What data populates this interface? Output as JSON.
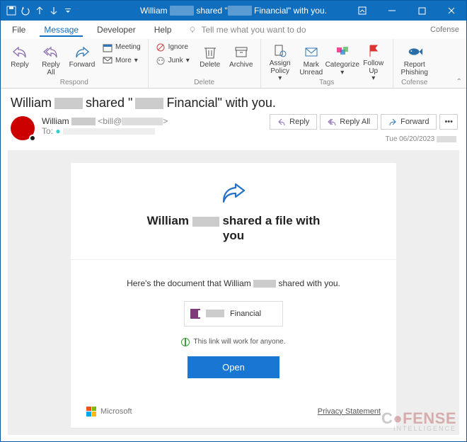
{
  "titlebar": {
    "title_prefix": "William",
    "title_mid": "shared \"",
    "title_suffix": "Financial\" with you."
  },
  "menu": {
    "file": "File",
    "message": "Message",
    "developer": "Developer",
    "help": "Help",
    "tellme": "Tell me what you want to do",
    "brand": "Cofense"
  },
  "ribbon": {
    "respond": {
      "reply": "Reply",
      "reply_all": "Reply\nAll",
      "forward": "Forward",
      "meeting": "Meeting",
      "more": "More",
      "group": "Respond"
    },
    "delete": {
      "ignore": "Ignore",
      "junk": "Junk",
      "delete": "Delete",
      "archive": "Archive",
      "group": "Delete"
    },
    "tags": {
      "assign_policy": "Assign\nPolicy",
      "mark_unread": "Mark\nUnread",
      "categorize": "Categorize",
      "follow_up": "Follow\nUp",
      "group": "Tags"
    },
    "cofense": {
      "report": "Report\nPhishing",
      "group": "Cofense"
    }
  },
  "header": {
    "subject_a": "William",
    "subject_b": "shared \"",
    "subject_c": "Financial\" with you.",
    "from_name": "William",
    "from_addr_a": "<bill@",
    "from_addr_b": ">",
    "to_label": "To:",
    "date": "Tue 06/20/2023",
    "reply": "Reply",
    "reply_all": "Reply All",
    "forward": "Forward"
  },
  "body": {
    "title_a": "William",
    "title_b": "shared a file with",
    "title_c": "you",
    "heres_a": "Here's the document that William",
    "heres_b": "shared with you.",
    "filename": "Financial",
    "link_note": "This link will work for anyone.",
    "open": "Open",
    "microsoft": "Microsoft",
    "privacy": "Privacy Statement"
  },
  "watermark": {
    "brand": "FENSE",
    "brand_pre": "C",
    "sub": "INTELLIGENCE"
  }
}
